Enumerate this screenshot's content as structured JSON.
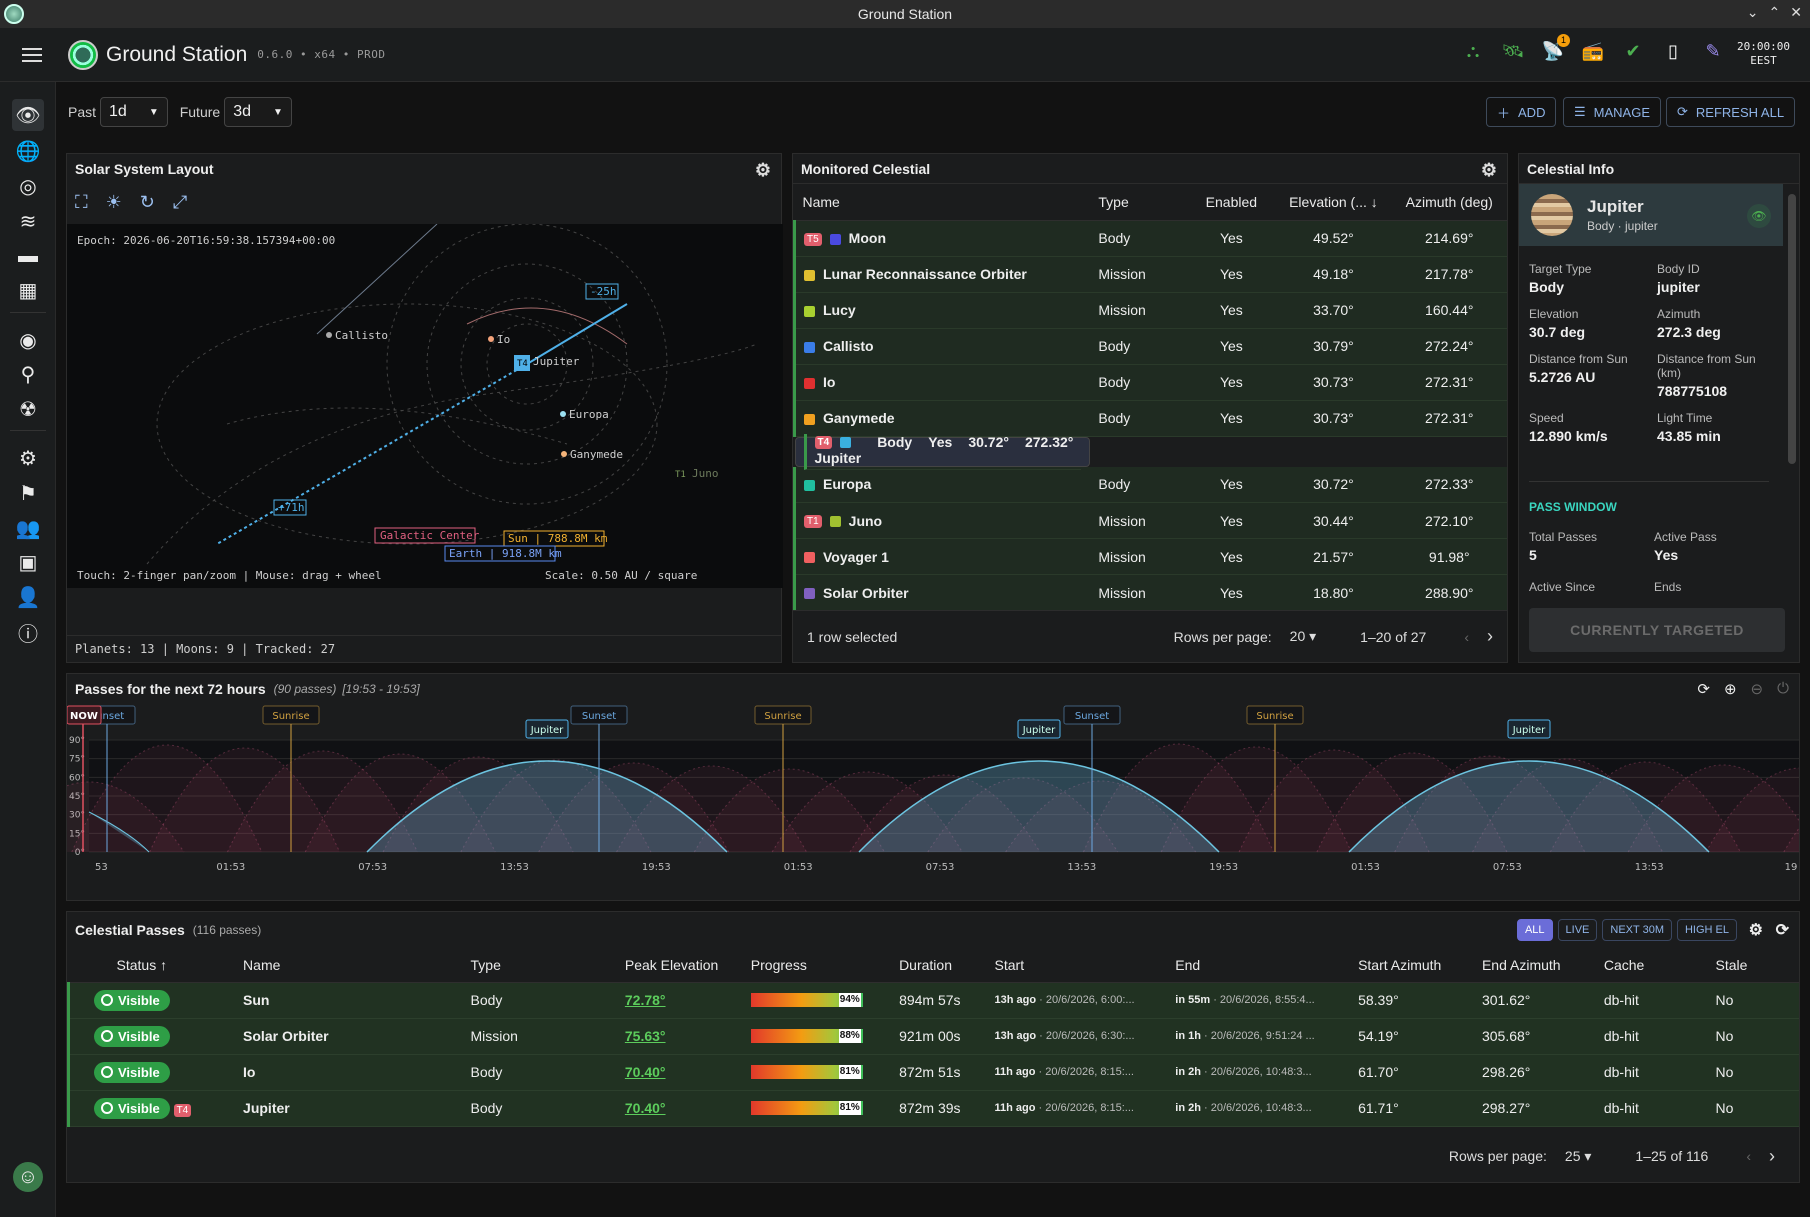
{
  "window": {
    "title": "Ground Station"
  },
  "app": {
    "title": "Ground Station",
    "version": "0.6.0 • x64 • PROD",
    "time": "20:00:00",
    "tz": "EEST",
    "notif_count": "1"
  },
  "toolbar": {
    "past_label": "Past",
    "past_value": "1d",
    "future_label": "Future",
    "future_value": "3d",
    "add": "ADD",
    "manage": "MANAGE",
    "refresh": "REFRESH ALL"
  },
  "solar": {
    "title": "Solar System Layout",
    "epoch": "Epoch: 2026-06-20T16:59:38.157394+00:00",
    "hint": "Touch: 2-finger pan/zoom | Mouse: drag + wheel",
    "scale": "Scale: 0.50 AU / square",
    "stats": "Planets: 13 | Moons: 9 | Tracked: 27",
    "labels": {
      "callisto": "Callisto",
      "io": "Io",
      "jupiter": "Jupiter",
      "europa": "Europa",
      "ganymede": "Ganymede",
      "juno": "Juno",
      "m25": "-25h",
      "p71": "+71h",
      "galactic": "Galactic Center",
      "sun": "Sun | 788.8M km",
      "earth": "Earth | 918.8M km",
      "t4": "T4",
      "t1": "T1"
    }
  },
  "monitored": {
    "title": "Monitored Celestial",
    "columns": [
      "Name",
      "Type",
      "Enabled",
      "Elevation (...",
      "Azimuth (deg)"
    ],
    "rows": [
      {
        "tag": "T5",
        "color": "#4a4ae0",
        "name": "Moon",
        "type": "Body",
        "enabled": "Yes",
        "elev": "49.52°",
        "az": "214.69°"
      },
      {
        "tag": "",
        "color": "#e0c030",
        "name": "Lunar Reconnaissance Orbiter",
        "type": "Mission",
        "enabled": "Yes",
        "elev": "49.18°",
        "az": "217.78°"
      },
      {
        "tag": "",
        "color": "#a8d030",
        "name": "Lucy",
        "type": "Mission",
        "enabled": "Yes",
        "elev": "33.70°",
        "az": "160.44°"
      },
      {
        "tag": "",
        "color": "#3a7de8",
        "name": "Callisto",
        "type": "Body",
        "enabled": "Yes",
        "elev": "30.79°",
        "az": "272.24°"
      },
      {
        "tag": "",
        "color": "#e03030",
        "name": "Io",
        "type": "Body",
        "enabled": "Yes",
        "elev": "30.73°",
        "az": "272.31°"
      },
      {
        "tag": "",
        "color": "#f0a020",
        "name": "Ganymede",
        "type": "Body",
        "enabled": "Yes",
        "elev": "30.73°",
        "az": "272.31°"
      },
      {
        "tag": "T4",
        "color": "#3ab0e0",
        "name": "Jupiter",
        "type": "Body",
        "enabled": "Yes",
        "elev": "30.72°",
        "az": "272.32°"
      },
      {
        "tag": "",
        "color": "#20c0a0",
        "name": "Europa",
        "type": "Body",
        "enabled": "Yes",
        "elev": "30.72°",
        "az": "272.33°"
      },
      {
        "tag": "T1",
        "color": "#a0c030",
        "name": "Juno",
        "type": "Mission",
        "enabled": "Yes",
        "elev": "30.44°",
        "az": "272.10°"
      },
      {
        "tag": "",
        "color": "#f06060",
        "name": "Voyager 1",
        "type": "Mission",
        "enabled": "Yes",
        "elev": "21.57°",
        "az": "91.98°"
      },
      {
        "tag": "",
        "color": "#8060c0",
        "name": "Solar Orbiter",
        "type": "Mission",
        "enabled": "Yes",
        "elev": "18.80°",
        "az": "288.90°"
      }
    ],
    "selected": "1 row selected",
    "rpp_label": "Rows per page:",
    "rpp": "20",
    "range": "1–20 of 27"
  },
  "info": {
    "title": "Celestial Info",
    "name": "Jupiter",
    "sub": "Body · jupiter",
    "fields": [
      {
        "k": "Target Type",
        "v": "Body"
      },
      {
        "k": "Body ID",
        "v": "jupiter"
      },
      {
        "k": "Elevation",
        "v": "30.7 deg"
      },
      {
        "k": "Azimuth",
        "v": "272.3 deg"
      },
      {
        "k": "Distance from Sun",
        "v": "5.2726 AU"
      },
      {
        "k": "Distance from Sun (km)",
        "v": "788775108"
      },
      {
        "k": "Speed",
        "v": "12.890 km/s"
      },
      {
        "k": "Light Time",
        "v": "43.85 min"
      }
    ],
    "pass_window": "PASS WINDOW",
    "total_label": "Total Passes",
    "total": "5",
    "active_label": "Active Pass",
    "active": "Yes",
    "since_label": "Active Since",
    "ends_label": "Ends",
    "button": "CURRENTLY TARGETED"
  },
  "passes_chart": {
    "title": "Passes for the next 72 hours",
    "count": "(90 passes)",
    "range": "[19:53 - 19:53]",
    "now": "NOW",
    "yticks": [
      "90°",
      "75°",
      "60°",
      "45°",
      "30°",
      "15°",
      "0°"
    ],
    "xticks": [
      "53",
      "01:53",
      "07:53",
      "13:53",
      "19:53",
      "01:53",
      "07:53",
      "13:53",
      "19:53",
      "01:53",
      "07:53",
      "13:53",
      "19"
    ],
    "events": [
      "Sunset",
      "Sunrise",
      "Sunset",
      "Sunrise",
      "Sunset",
      "Sunrise"
    ],
    "peaks": [
      "Jupiter",
      "Jupiter",
      "Jupiter"
    ]
  },
  "cpasses": {
    "title": "Celestial Passes",
    "count": "(116 passes)",
    "filters": [
      "ALL",
      "LIVE",
      "NEXT 30M",
      "HIGH EL"
    ],
    "columns": [
      "Status",
      "Name",
      "Type",
      "Peak Elevation",
      "Progress",
      "Duration",
      "Start",
      "End",
      "Start Azimuth",
      "End Azimuth",
      "Cache",
      "Stale"
    ],
    "rows": [
      {
        "status": "Visible",
        "tag": "",
        "name": "Sun",
        "type": "Body",
        "peak": "72.78°",
        "progress": 0.94,
        "pct": "94%",
        "dur": "894m 57s",
        "start_rel": "13h ago",
        "start": "· 20/6/2026, 6:00:...",
        "end_rel": "in 55m",
        "end": "· 20/6/2026, 8:55:4...",
        "saz": "58.39°",
        "eaz": "301.62°",
        "cache": "db-hit",
        "stale": "No"
      },
      {
        "status": "Visible",
        "tag": "",
        "name": "Solar Orbiter",
        "type": "Mission",
        "peak": "75.63°",
        "progress": 0.88,
        "pct": "88%",
        "dur": "921m 00s",
        "start_rel": "13h ago",
        "start": "· 20/6/2026, 6:30:...",
        "end_rel": "in 1h",
        "end": "· 20/6/2026, 9:51:24 ...",
        "saz": "54.19°",
        "eaz": "305.68°",
        "cache": "db-hit",
        "stale": "No"
      },
      {
        "status": "Visible",
        "tag": "",
        "name": "Io",
        "type": "Body",
        "peak": "70.40°",
        "progress": 0.81,
        "pct": "81%",
        "dur": "872m 51s",
        "start_rel": "11h ago",
        "start": "· 20/6/2026, 8:15:...",
        "end_rel": "in 2h",
        "end": "· 20/6/2026, 10:48:3...",
        "saz": "61.70°",
        "eaz": "298.26°",
        "cache": "db-hit",
        "stale": "No"
      },
      {
        "status": "Visible",
        "tag": "T4",
        "name": "Jupiter",
        "type": "Body",
        "peak": "70.40°",
        "progress": 0.81,
        "pct": "81%",
        "dur": "872m 39s",
        "start_rel": "11h ago",
        "start": "· 20/6/2026, 8:15:...",
        "end_rel": "in 2h",
        "end": "· 20/6/2026, 10:48:3...",
        "saz": "61.71°",
        "eaz": "298.27°",
        "cache": "db-hit",
        "stale": "No"
      }
    ],
    "rpp_label": "Rows per page:",
    "rpp": "25",
    "range": "1–25 of 116"
  }
}
